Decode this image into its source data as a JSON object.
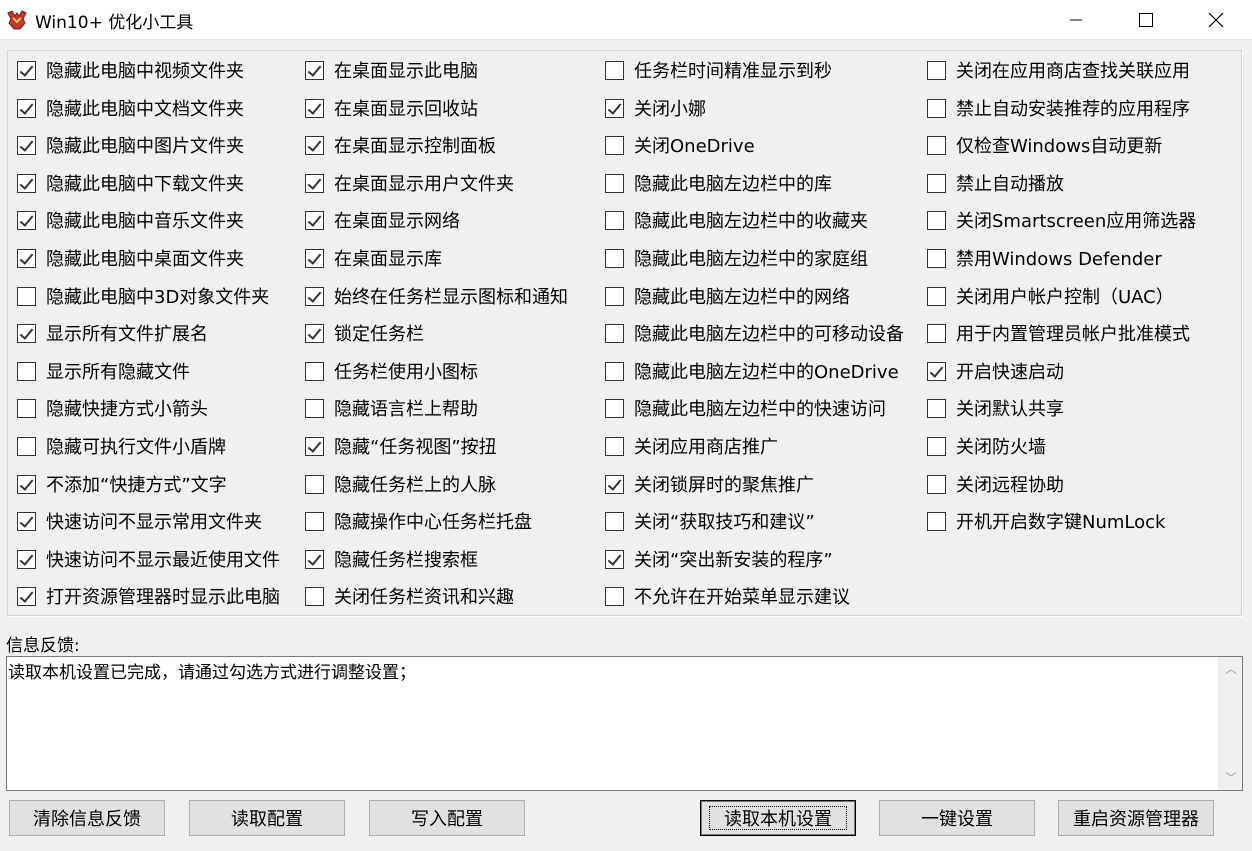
{
  "window": {
    "title": "Win10+ 优化小工具",
    "controls": {
      "minimize": "minimize-icon",
      "maximize": "maximize-icon",
      "close": "close-icon"
    }
  },
  "options": {
    "col1": [
      {
        "label": "隐藏此电脑中视频文件夹",
        "checked": true
      },
      {
        "label": "隐藏此电脑中文档文件夹",
        "checked": true
      },
      {
        "label": "隐藏此电脑中图片文件夹",
        "checked": true
      },
      {
        "label": "隐藏此电脑中下载文件夹",
        "checked": true
      },
      {
        "label": "隐藏此电脑中音乐文件夹",
        "checked": true
      },
      {
        "label": "隐藏此电脑中桌面文件夹",
        "checked": true
      },
      {
        "label": "隐藏此电脑中3D对象文件夹",
        "checked": false
      },
      {
        "label": "显示所有文件扩展名",
        "checked": true
      },
      {
        "label": "显示所有隐藏文件",
        "checked": false
      },
      {
        "label": "隐藏快捷方式小箭头",
        "checked": false
      },
      {
        "label": "隐藏可执行文件小盾牌",
        "checked": false
      },
      {
        "label": "不添加“快捷方式”文字",
        "checked": true
      },
      {
        "label": "快速访问不显示常用文件夹",
        "checked": true
      },
      {
        "label": "快速访问不显示最近使用文件",
        "checked": true
      },
      {
        "label": "打开资源管理器时显示此电脑",
        "checked": true
      }
    ],
    "col2": [
      {
        "label": "在桌面显示此电脑",
        "checked": true
      },
      {
        "label": "在桌面显示回收站",
        "checked": true
      },
      {
        "label": "在桌面显示控制面板",
        "checked": true
      },
      {
        "label": "在桌面显示用户文件夹",
        "checked": true
      },
      {
        "label": "在桌面显示网络",
        "checked": true
      },
      {
        "label": "在桌面显示库",
        "checked": true
      },
      {
        "label": "始终在任务栏显示图标和通知",
        "checked": true
      },
      {
        "label": "锁定任务栏",
        "checked": true
      },
      {
        "label": "任务栏使用小图标",
        "checked": false
      },
      {
        "label": "隐藏语言栏上帮助",
        "checked": false
      },
      {
        "label": "隐藏“任务视图”按扭",
        "checked": true
      },
      {
        "label": "隐藏任务栏上的人脉",
        "checked": false
      },
      {
        "label": "隐藏操作中心任务栏托盘",
        "checked": false
      },
      {
        "label": "隐藏任务栏搜索框",
        "checked": true
      },
      {
        "label": "关闭任务栏资讯和兴趣",
        "checked": false
      }
    ],
    "col3": [
      {
        "label": "任务栏时间精准显示到秒",
        "checked": false
      },
      {
        "label": "关闭小娜",
        "checked": true
      },
      {
        "label": "关闭OneDrive",
        "checked": false
      },
      {
        "label": "隐藏此电脑左边栏中的库",
        "checked": false
      },
      {
        "label": "隐藏此电脑左边栏中的收藏夹",
        "checked": false
      },
      {
        "label": "隐藏此电脑左边栏中的家庭组",
        "checked": false
      },
      {
        "label": "隐藏此电脑左边栏中的网络",
        "checked": false
      },
      {
        "label": "隐藏此电脑左边栏中的可移动设备",
        "checked": false
      },
      {
        "label": "隐藏此电脑左边栏中的OneDrive",
        "checked": false
      },
      {
        "label": "隐藏此电脑左边栏中的快速访问",
        "checked": false
      },
      {
        "label": "关闭应用商店推广",
        "checked": false
      },
      {
        "label": "关闭锁屏时的聚焦推广",
        "checked": true
      },
      {
        "label": "关闭“获取技巧和建议”",
        "checked": false
      },
      {
        "label": "关闭“突出新安装的程序”",
        "checked": true
      },
      {
        "label": "不允许在开始菜单显示建议",
        "checked": false
      }
    ],
    "col4": [
      {
        "label": "关闭在应用商店查找关联应用",
        "checked": false
      },
      {
        "label": "禁止自动安装推荐的应用程序",
        "checked": false
      },
      {
        "label": "仅检查Windows自动更新",
        "checked": false
      },
      {
        "label": "禁止自动播放",
        "checked": false
      },
      {
        "label": "关闭Smartscreen应用筛选器",
        "checked": false
      },
      {
        "label": "禁用Windows Defender",
        "checked": false
      },
      {
        "label": "关闭用户帐户控制（UAC）",
        "checked": false
      },
      {
        "label": "用于内置管理员帐户批准模式",
        "checked": false
      },
      {
        "label": "开启快速启动",
        "checked": true
      },
      {
        "label": "关闭默认共享",
        "checked": false
      },
      {
        "label": "关闭防火墙",
        "checked": false
      },
      {
        "label": "关闭远程协助",
        "checked": false
      },
      {
        "label": "开机开启数字键NumLock",
        "checked": false
      }
    ]
  },
  "feedback": {
    "label": "信息反馈:",
    "text": "读取本机设置已完成，请通过勾选方式进行调整设置；"
  },
  "buttons": {
    "clear": "清除信息反馈",
    "read_config": "读取配置",
    "write_config": "写入配置",
    "read_local": "读取本机设置",
    "one_click": "一键设置",
    "restart_explorer": "重启资源管理器"
  }
}
